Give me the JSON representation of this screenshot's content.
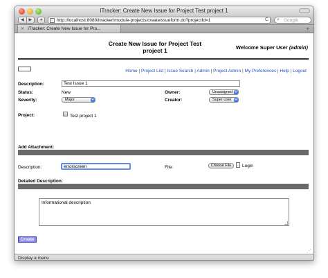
{
  "window": {
    "title": "ITracker: Create New Issue for Project Test project 1"
  },
  "toolbar": {
    "back_glyph": "◀",
    "forward_glyph": "▶",
    "add_glyph": "+",
    "url": "http://localhost:8080/itracker/module-projects/createissueform.do?projectId=1",
    "reload_glyph": "C",
    "search_placeholder": "Google",
    "search_glyph": "⌕"
  },
  "tab": {
    "close_glyph": "✕",
    "label": "ITracker: Create New Issue for Pro...",
    "new_tab_glyph": "+"
  },
  "header": {
    "title_line1": "Create New Issue for Project Test",
    "title_line2": "project 1",
    "welcome_prefix": "Welcome Super User",
    "welcome_user": "(admin)"
  },
  "nav": {
    "links": [
      "Home",
      "Project List",
      "Issue Search",
      "Admin",
      "Project Admin",
      "My Preferences",
      "Help",
      "Logout"
    ],
    "separator": "|"
  },
  "form": {
    "description_label": "Description:",
    "description_value": "Test Issue 1",
    "status_label": "Status:",
    "status_value": "New",
    "owner_label": "Owner:",
    "owner_value": "Unassigned",
    "severity_label": "Severity:",
    "severity_value": "Major",
    "creator_label": "Creator:",
    "creator_value": "Super User",
    "project_label": "Project:",
    "project_value": "Test project 1"
  },
  "attachment": {
    "section_label": "Add Attachment:",
    "description_label": "Description:",
    "description_value": "errorscreen",
    "file_label": "File:",
    "choose_button": "Choose File",
    "file_name": "Login"
  },
  "detailed": {
    "section_label": "Detailed Description:",
    "text": "Informational description"
  },
  "actions": {
    "create_label": "Create"
  },
  "statusbar": {
    "text": "Display a menu"
  },
  "colors": {
    "link": "#2550c0",
    "bar": "#6a6a6a",
    "create_button": "#8888ee",
    "focus": "#5b8ee6"
  }
}
